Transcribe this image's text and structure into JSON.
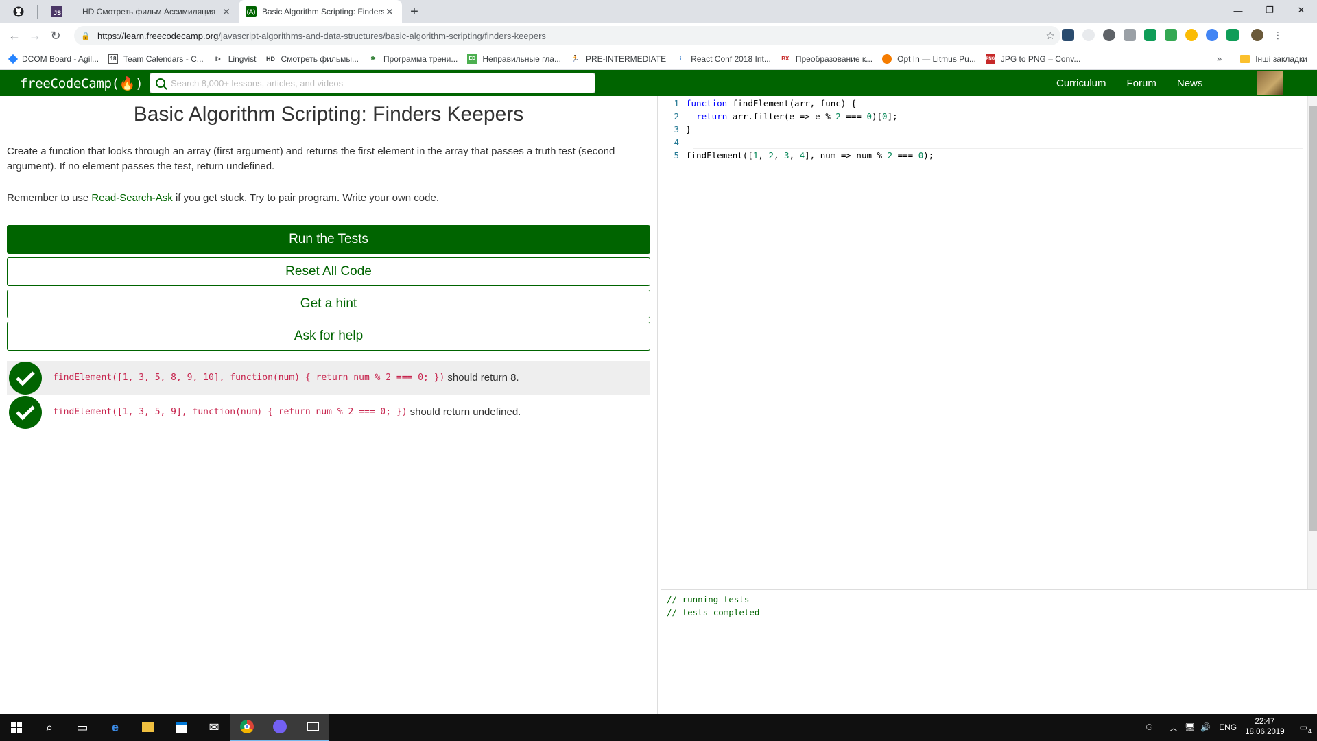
{
  "browser": {
    "tabs": [
      {
        "label": "",
        "icon": "github-icon"
      },
      {
        "label": "",
        "icon": "js-icon"
      },
      {
        "label": "HD  Смотреть фильм Ассимиляция",
        "icon": "hd-icon"
      },
      {
        "label": "Basic Algorithm Scripting: Finders",
        "icon": "fcc-icon",
        "active": true
      }
    ],
    "url_host": "https://learn.freecodecamp.org",
    "url_path": "/javascript-algorithms-and-data-structures/basic-algorithm-scripting/finders-keepers",
    "bookmarks": [
      "DCOM Board - Agil...",
      "Team Calendars - C...",
      "Lingvist",
      "Смотреть фильмы...",
      "Программа трени...",
      "Неправильные гла...",
      "PRE-INTERMEDIATE",
      "React Conf 2018 Int...",
      "Преобразование к...",
      "Opt In — Litmus Pu...",
      "JPG to PNG – Conv..."
    ],
    "other_bookmarks": "Інші закладки",
    "window_controls": [
      "—",
      "❐",
      "✕"
    ]
  },
  "fcc": {
    "logo": "freeCodeCamp(🔥)",
    "search_placeholder": "Search 8,000+ lessons, articles, and videos",
    "nav": [
      "Curriculum",
      "Forum",
      "News"
    ]
  },
  "challenge": {
    "title": "Basic Algorithm Scripting: Finders Keepers",
    "description": "Create a function that looks through an array (first argument) and returns the first element in the array that passes a truth test (second argument). If no element passes the test, return undefined.",
    "remember_prefix": "Remember to use ",
    "remember_link": "Read-Search-Ask",
    "remember_suffix": " if you get stuck. Try to pair program. Write your own code.",
    "buttons": {
      "run": "Run the Tests",
      "reset": "Reset All Code",
      "hint": "Get a hint",
      "help": "Ask for help"
    },
    "tests": [
      {
        "code": "findElement([1, 3, 5, 8, 9, 10], function(num) { return num % 2 === 0; })",
        "text": " should return 8.",
        "passed": true
      },
      {
        "code": "findElement([1, 3, 5, 9], function(num) { return num % 2 === 0; })",
        "text": " should return undefined.",
        "passed": true
      }
    ]
  },
  "editor": {
    "line_numbers": [
      "1",
      "2",
      "3",
      "4",
      "5"
    ]
  },
  "console": {
    "lines": [
      "// running tests",
      "// tests completed"
    ]
  },
  "taskbar": {
    "lang": "ENG",
    "time": "22:47",
    "date": "18.06.2019",
    "notifications": "4"
  }
}
